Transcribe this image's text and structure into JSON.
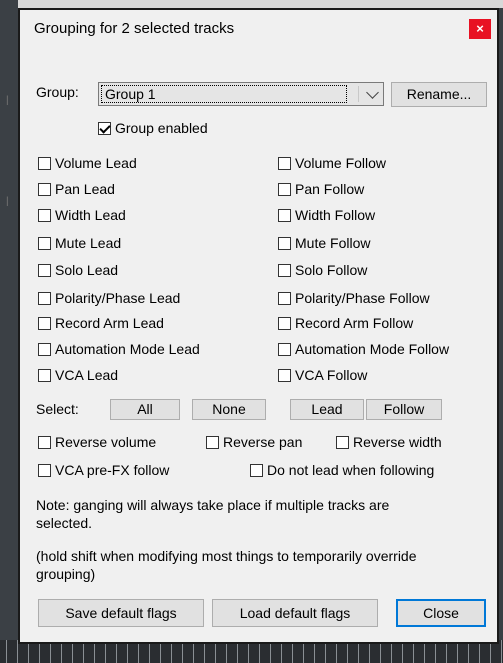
{
  "window": {
    "title": "Grouping for 2 selected tracks",
    "close_glyph": "×"
  },
  "group": {
    "label": "Group:",
    "selected": "Group 1",
    "rename_label": "Rename...",
    "enabled_label": "Group enabled",
    "enabled": true
  },
  "flags_left": [
    {
      "label": "Volume Lead",
      "checked": false
    },
    {
      "label": "Pan Lead",
      "checked": false
    },
    {
      "label": "Width Lead",
      "checked": false
    },
    {
      "label": "Mute Lead",
      "checked": false
    },
    {
      "label": "Solo Lead",
      "checked": false
    },
    {
      "label": "Polarity/Phase Lead",
      "checked": false
    },
    {
      "label": "Record Arm Lead",
      "checked": false
    },
    {
      "label": "Automation Mode Lead",
      "checked": false
    },
    {
      "label": "VCA Lead",
      "checked": false
    }
  ],
  "flags_right": [
    {
      "label": "Volume Follow",
      "checked": false
    },
    {
      "label": "Pan Follow",
      "checked": false
    },
    {
      "label": "Width Follow",
      "checked": false
    },
    {
      "label": "Mute Follow",
      "checked": false
    },
    {
      "label": "Solo Follow",
      "checked": false
    },
    {
      "label": "Polarity/Phase Follow",
      "checked": false
    },
    {
      "label": "Record Arm Follow",
      "checked": false
    },
    {
      "label": "Automation Mode Follow",
      "checked": false
    },
    {
      "label": "VCA Follow",
      "checked": false
    }
  ],
  "select": {
    "label": "Select:",
    "all": "All",
    "none": "None",
    "lead": "Lead",
    "follow": "Follow"
  },
  "options": {
    "reverse_volume": "Reverse volume",
    "reverse_pan": "Reverse pan",
    "reverse_width": "Reverse width",
    "vca_prefx": "VCA pre-FX follow",
    "no_lead_following": "Do not lead when following"
  },
  "notes": {
    "line1": "Note: ganging will always take place if multiple tracks are",
    "line2": "selected.",
    "line3": "(hold shift when modifying most things to temporarily override",
    "line4": "grouping)"
  },
  "footer": {
    "save_label": "Save default flags",
    "load_label": "Load default flags",
    "close_label": "Close"
  },
  "colors": {
    "dialog_bg": "#f0f0f0",
    "close_bg": "#e81123",
    "default_button_border": "#0078d7"
  }
}
